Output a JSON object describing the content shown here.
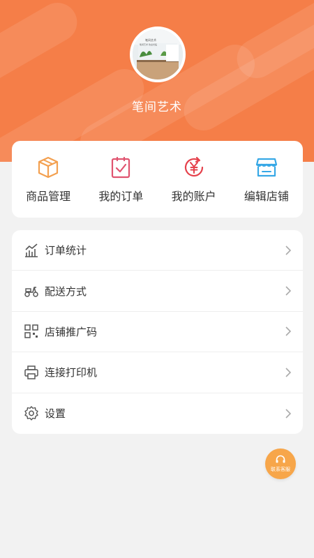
{
  "header": {
    "shop_name": "笔间艺术",
    "avatar_text_line1": "笔间艺术",
    "avatar_text_line2": "笔间艺术 欢迎光临",
    "colors": {
      "primary": "#f57e48",
      "white": "#ffffff"
    }
  },
  "quick_actions": [
    {
      "label": "商品管理",
      "icon": "box-icon",
      "color": "#f3a050"
    },
    {
      "label": "我的订单",
      "icon": "clipboard-check-icon",
      "color": "#e0536f"
    },
    {
      "label": "我的账户",
      "icon": "yen-refresh-icon",
      "color": "#e5414b"
    },
    {
      "label": "编辑店铺",
      "icon": "storefront-icon",
      "color": "#37a8e6"
    }
  ],
  "menu": [
    {
      "label": "订单统计",
      "icon": "chart-icon"
    },
    {
      "label": "配送方式",
      "icon": "scooter-icon"
    },
    {
      "label": "店铺推广码",
      "icon": "qr-code-icon"
    },
    {
      "label": "连接打印机",
      "icon": "printer-icon"
    },
    {
      "label": "设置",
      "icon": "gear-icon"
    }
  ],
  "customer_service": {
    "label": "联系客服",
    "icon": "headset-icon",
    "color": "#f7a64a"
  }
}
